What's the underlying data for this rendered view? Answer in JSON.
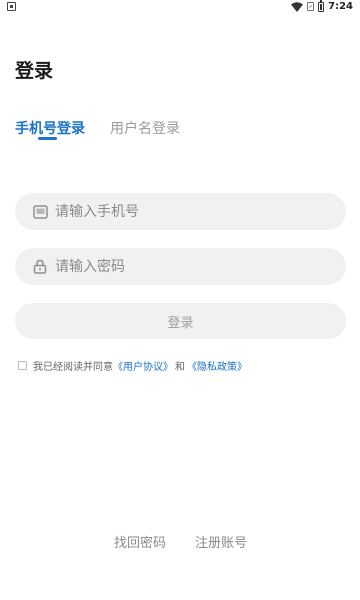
{
  "status_bar": {
    "time": "7:24"
  },
  "page": {
    "title": "登录"
  },
  "tabs": [
    {
      "label": "手机号登录",
      "active": true
    },
    {
      "label": "用户名登录",
      "active": false
    }
  ],
  "form": {
    "phone_placeholder": "请输入手机号",
    "password_placeholder": "请输入密码",
    "login_button": "登录"
  },
  "agreement": {
    "prefix": "我已经阅读并同意",
    "user_agreement": "《用户协议》",
    "conjunction": "和",
    "privacy_policy": "《隐私政策》",
    "checked": false
  },
  "footer": {
    "forgot_password": "找回密码",
    "register": "注册账号"
  },
  "colors": {
    "accent": "#1a73c7",
    "field_bg": "#eff1f3",
    "muted_text": "#8a8a8a"
  },
  "icons": [
    "android-notification-icon",
    "wifi-icon",
    "sim-icon",
    "battery-icon",
    "phone-device-icon",
    "lock-icon"
  ]
}
